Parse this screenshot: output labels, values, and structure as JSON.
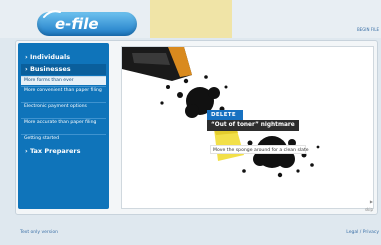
{
  "logo": {
    "text": "e-file"
  },
  "header": {
    "top_link": "BEGIN FILE"
  },
  "sidebar": {
    "items": [
      {
        "label": "› Individuals"
      },
      {
        "label": "› Businesses"
      },
      {
        "label": "› Tax Preparers"
      }
    ],
    "sub_items": [
      {
        "label": "More forms than ever"
      },
      {
        "label": "More convenient than paper filing"
      },
      {
        "label": "Electronic payment options"
      },
      {
        "label": "More accurate than paper filing"
      },
      {
        "label": "Getting started"
      }
    ]
  },
  "stage": {
    "delete_label": "DELETE",
    "title": "“Out of toner” nightmare",
    "caption": "Move the sponge around for a clean slate",
    "skip_label": "▶ skip"
  },
  "footer": {
    "left_link": "Text only version",
    "right_link": "Legal / Privacy"
  },
  "colors": {
    "brand_blue": "#0f74ba",
    "accent_blue": "#1771c1",
    "gold": "#f6dd68",
    "sponge_yellow": "#f2e04a"
  }
}
